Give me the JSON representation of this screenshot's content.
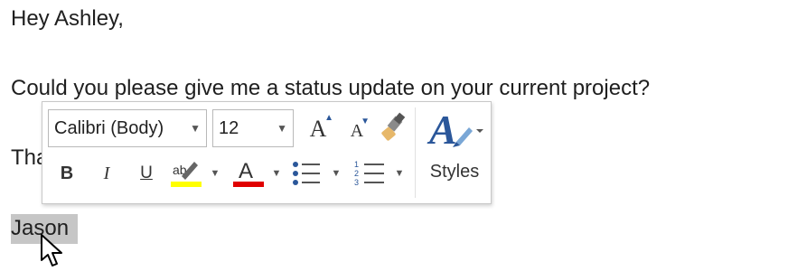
{
  "document": {
    "greeting": "Hey Ashley,",
    "body": "Could you please give me a status update on your current project?",
    "thanks": "Thanks,",
    "signature": "Jason"
  },
  "mini_toolbar": {
    "font_name": "Calibri (Body)",
    "font_size": "12",
    "grow_font_glyph": "A",
    "shrink_font_glyph": "A",
    "bold_glyph": "B",
    "italic_glyph": "I",
    "underline_glyph": "U",
    "highlight_glyph": "ab",
    "highlight_color": "#ffff00",
    "font_color_glyph": "A",
    "font_color": "#e00000",
    "styles_glyph": "A",
    "styles_label": "Styles"
  },
  "colors": {
    "selection": "#c6c6c6",
    "accent_blue": "#2b579a"
  },
  "icons": [
    "grow-font-icon",
    "shrink-font-icon",
    "format-painter-icon",
    "highlight-icon",
    "font-color-icon",
    "bullets-icon",
    "numbering-icon",
    "styles-icon",
    "mouse-pointer-icon"
  ]
}
